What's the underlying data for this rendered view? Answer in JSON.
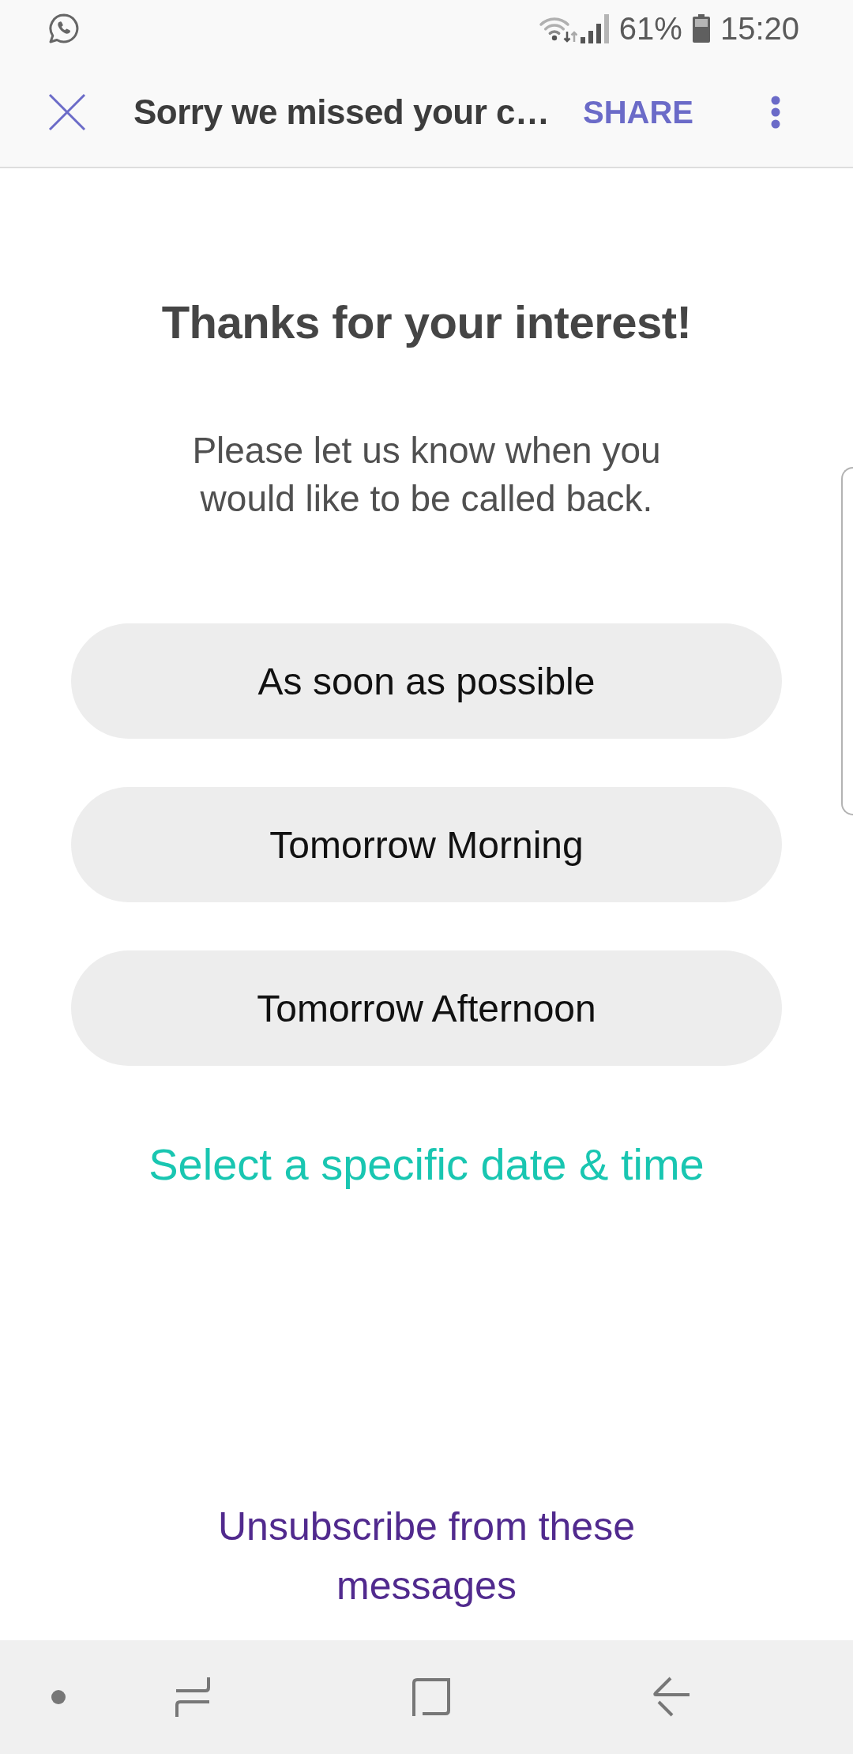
{
  "status_bar": {
    "battery_percent": "61%",
    "time": "15:20"
  },
  "toolbar": {
    "title": "Sorry we missed your c…",
    "action": "SHARE"
  },
  "content": {
    "heading": "Thanks for your interest!",
    "message": "Please let us know when you would like to be called back.",
    "options": [
      "As soon as possible",
      "Tomorrow Morning",
      "Tomorrow Afternoon"
    ],
    "date_link": "Select a specific date & time",
    "unsubscribe_link": "Unsubscribe from these messages"
  }
}
